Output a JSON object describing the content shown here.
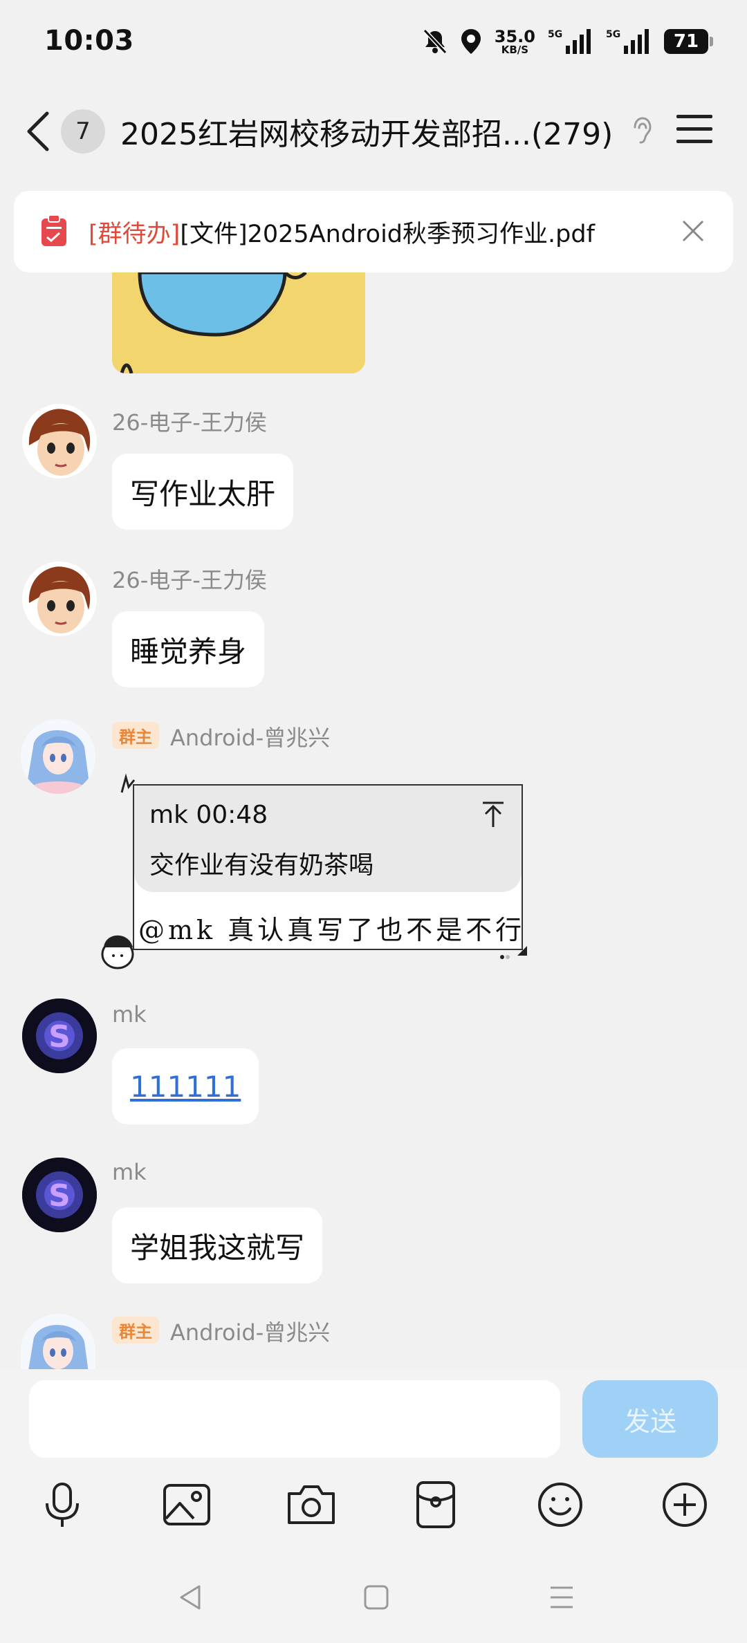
{
  "status": {
    "time": "10:03",
    "net_speed": "35.0",
    "net_unit": "KB/S",
    "signal1": "5G",
    "signal2": "5G",
    "battery": "71"
  },
  "header": {
    "unread": "7",
    "title": "2025红岩网校移动开发部招...(279)"
  },
  "todo": {
    "tag": "[群待办]",
    "text": "[文件]2025Android秋季预习作业.pdf"
  },
  "messages": [
    {
      "nick": "26-电子-王力侯",
      "text": "写作业太肝"
    },
    {
      "nick": "26-电子-王力侯",
      "text": "睡觉养身"
    },
    {
      "badge": "群主",
      "nick": "Android-曾兆兴",
      "quote_meta": "mk 00:48",
      "quote_text": "交作业有没有奶茶喝",
      "text": "@mk 真认真写了也不是不行"
    },
    {
      "nick": "mk",
      "text": "111111"
    },
    {
      "nick": "mk",
      "text": "学姐我这就写"
    },
    {
      "badge": "群主",
      "nick": "Android-曾兆兴"
    }
  ],
  "composer": {
    "placeholder": "",
    "send_label": "发送"
  },
  "toolbar": [
    "microphone-icon",
    "image-icon",
    "camera-icon",
    "red-packet-icon",
    "emoji-icon",
    "plus-icon"
  ],
  "colors": {
    "accent": "#e04a3a",
    "send": "#9fd0f6",
    "link": "#2f6fd6",
    "owner": "#e8863a"
  }
}
